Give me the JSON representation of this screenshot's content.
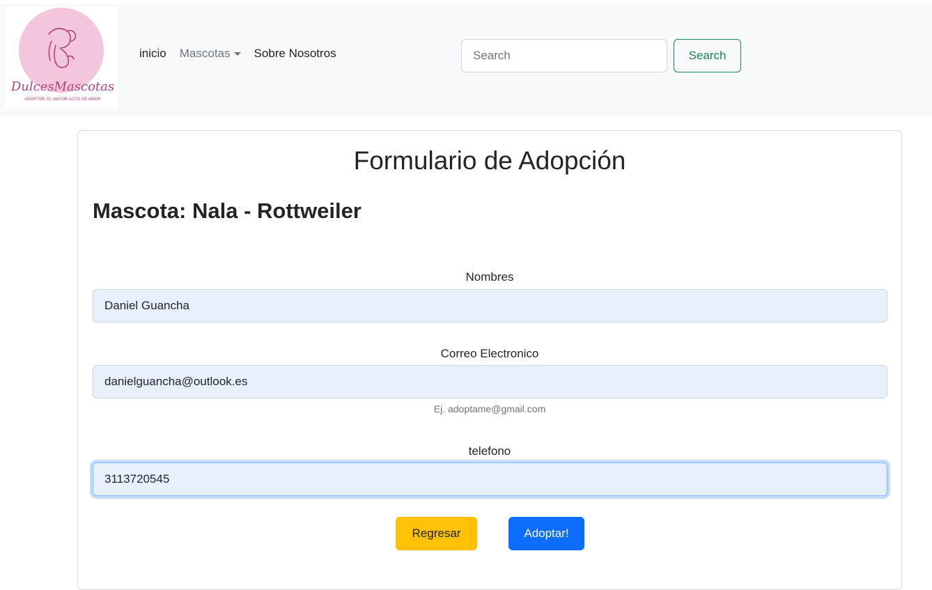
{
  "brand": {
    "name": "DulcesMascotas",
    "tagline": "ADOPTAR, EL MAYOR ACTO DE AMOR",
    "colors": {
      "circle": "#f4c6de",
      "ink": "#b0437c"
    }
  },
  "nav": {
    "items": [
      {
        "label": "inicio"
      },
      {
        "label": "Mascotas"
      },
      {
        "label": "Sobre Nosotros"
      }
    ],
    "search": {
      "placeholder": "Search",
      "button_label": "Search"
    }
  },
  "form": {
    "title": "Formulario de Adopción",
    "pet_prefix": "Mascota: ",
    "pet_name": "Nala - Rottweiler",
    "fields": [
      {
        "label": "Nombres",
        "value": "Daniel Guancha"
      },
      {
        "label": "Correo Electronico",
        "value": "danielguancha@outlook.es",
        "help": "Ej. adoptame@gmail.com"
      },
      {
        "label": "telefono",
        "value": "3113720545"
      }
    ],
    "buttons": {
      "back": "Regresar",
      "adopt": "Adoptar!"
    }
  },
  "colors": {
    "navbar_bg": "#f8f9fa",
    "success": "#198754",
    "warning": "#ffc107",
    "primary": "#0d6efd",
    "autofill_bg": "#e8f0fe"
  }
}
